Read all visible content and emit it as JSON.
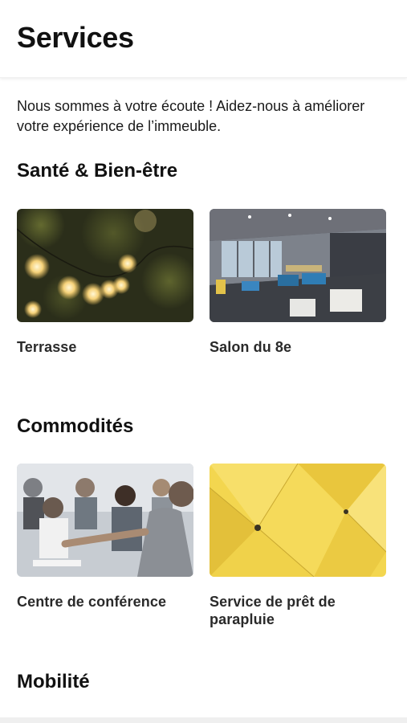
{
  "header": {
    "title": "Services"
  },
  "intro": {
    "text": "Nous sommes à votre écoute ! Aidez-nous à améliorer votre expérience de l’immeuble."
  },
  "sections": [
    {
      "title": "Santé & Bien-être",
      "cards": [
        {
          "label": "Terrasse",
          "image": "string-lights-photo"
        },
        {
          "label": "Salon du 8e",
          "image": "lounge-photo"
        }
      ]
    },
    {
      "title": "Commodités",
      "cards": [
        {
          "label": "Centre de conférence",
          "image": "conference-photo"
        },
        {
          "label": "Service de prêt de parapluie",
          "image": "umbrellas-photo"
        }
      ]
    },
    {
      "title": "Mobilité",
      "cards": []
    }
  ],
  "colors": {
    "accent_yellow": "#f3d64f",
    "text": "#111111"
  }
}
